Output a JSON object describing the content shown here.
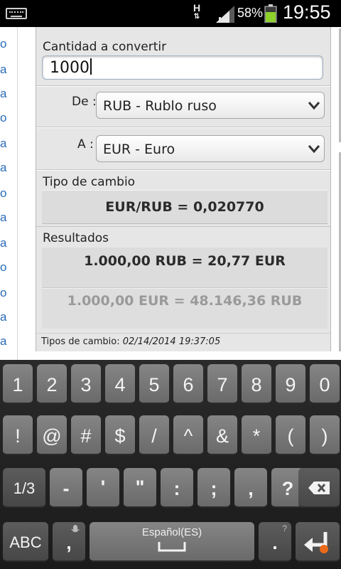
{
  "status_bar": {
    "network_type": "H",
    "battery_percent": "58%",
    "time": "19:55"
  },
  "background_page": {
    "left_letters": [
      "o",
      "a",
      "a",
      "o",
      "a",
      "a",
      "o",
      "a",
      "a",
      "o",
      "o",
      "a",
      "a"
    ]
  },
  "converter": {
    "amount_label": "Cantidad a convertir",
    "amount_value": "1000",
    "from_label": "De :",
    "from_value": "RUB - Rublo ruso",
    "to_label": "A :",
    "to_value": "EUR - Euro",
    "rate_label": "Tipo de cambio",
    "rate_value": "EUR/RUB = 0,020770",
    "results_label": "Resultados",
    "result_primary": "1.000,00 RUB = 20,77 EUR",
    "result_secondary": "1.000,00 EUR = 48.146,36 RUB",
    "footer_label": "Tipos de cambio:",
    "footer_date": "02/14/2014 19:37:05"
  },
  "keyboard": {
    "row1": [
      "1",
      "2",
      "3",
      "4",
      "5",
      "6",
      "7",
      "8",
      "9",
      "0"
    ],
    "row2": [
      "!",
      "@",
      "#",
      "$",
      "/",
      "^",
      "&",
      "*",
      "(",
      ")"
    ],
    "row3": [
      "1/3",
      "-",
      "'",
      "\"",
      ":",
      ";",
      ",",
      "?"
    ],
    "abc_label": "ABC",
    "comma_label": ",",
    "space_label": "Español(ES)",
    "period_label": ".",
    "icons": {
      "backspace": "backspace-icon",
      "mic": "mic-icon",
      "enter": "enter-icon"
    }
  }
}
